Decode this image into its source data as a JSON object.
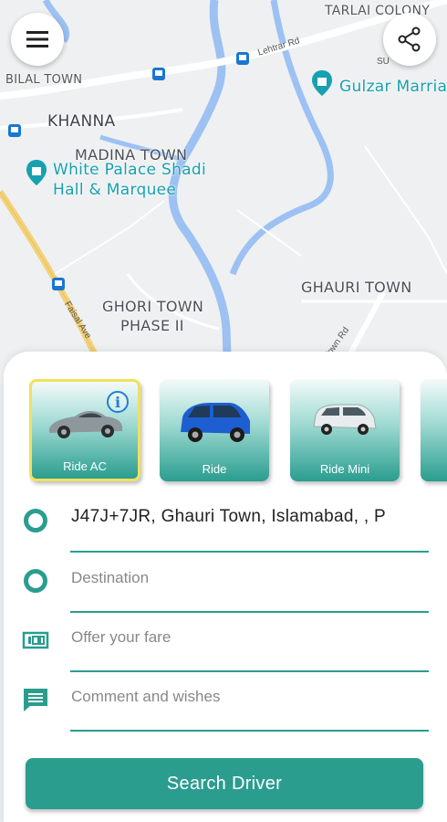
{
  "map": {
    "labels": {
      "tarlai": "TARLAI COLONY",
      "bilal": "BILAL TOWN",
      "khanna": "KHANNA",
      "madina": "MADINA TOWN",
      "white_palace": "White Palace Shadi\nHall & Marquee",
      "gulzar": "Gulzar Marriag",
      "ghauri": "GHAURI TOWN",
      "ghori_l1": "GHORI TOWN",
      "ghori_l2": "PHASE II",
      "lehtrar": "Lehtrar Rd",
      "faisal": "Faisal Ave",
      "town_rd": "Town Rd",
      "su": "SU"
    }
  },
  "top_bar": {
    "menu_icon": "hamburger-menu-icon",
    "share_icon": "share-icon"
  },
  "ride_options": [
    {
      "name": "Ride AC",
      "selected": true,
      "car_color": "#8e979c"
    },
    {
      "name": "Ride",
      "selected": false,
      "car_color": "#1d5fd0"
    },
    {
      "name": "Ride Mini",
      "selected": false,
      "car_color": "#e8ecee"
    }
  ],
  "form": {
    "pickup_value": "J47J+7JR, Ghauri Town, Islamabad, , P",
    "destination_placeholder": "Destination",
    "fare_placeholder": "Offer your fare",
    "comment_placeholder": "Comment and wishes"
  },
  "search_button_label": "Search Driver",
  "colors": {
    "accent": "#2a9d8f",
    "selected_border": "#f1e15c",
    "river": "#8fbaf0",
    "info": "#1e7fd6"
  }
}
